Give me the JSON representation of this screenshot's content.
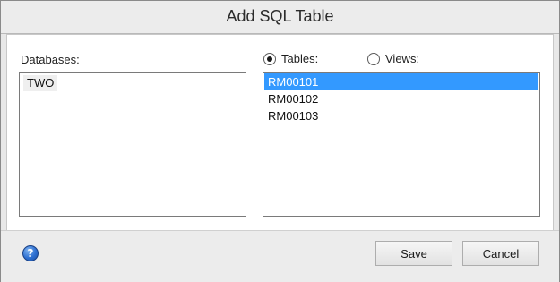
{
  "window": {
    "title": "Add SQL Table"
  },
  "databases": {
    "label": "Databases:",
    "items": [
      "TWO"
    ]
  },
  "source": {
    "tables_label": "Tables:",
    "views_label": "Views:",
    "selected": "Tables"
  },
  "tables": {
    "items": [
      "RM00101",
      "RM00102",
      "RM00103"
    ],
    "selected": "RM00101"
  },
  "footer": {
    "help_icon": "help-icon",
    "save_label": "Save",
    "cancel_label": "Cancel"
  },
  "colors": {
    "selection": "#3399ff",
    "window_bg": "#e8e8e8"
  }
}
